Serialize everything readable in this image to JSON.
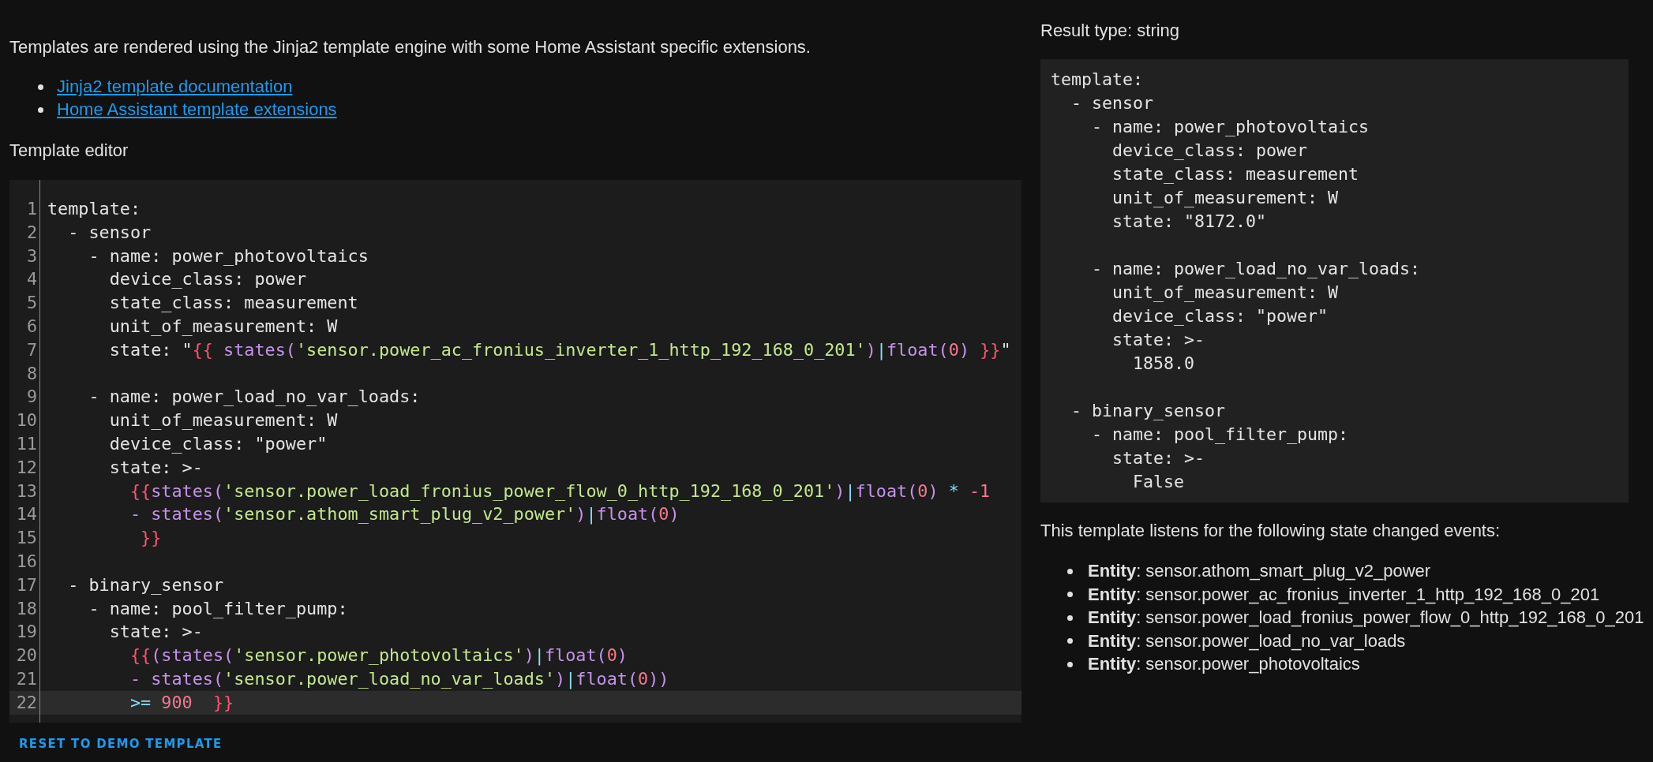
{
  "intro": "Templates are rendered using the Jinja2 template engine with some Home Assistant specific extensions.",
  "links": [
    "Jinja2 template documentation",
    "Home Assistant template extensions"
  ],
  "editor_label": "Template editor",
  "editor": {
    "lines": [
      {
        "number": "1",
        "active": false,
        "tokens": [
          {
            "kind": "plain",
            "text": "template:"
          }
        ]
      },
      {
        "number": "2",
        "active": false,
        "tokens": [
          {
            "kind": "plain",
            "text": "  - sensor"
          }
        ]
      },
      {
        "number": "3",
        "active": false,
        "tokens": [
          {
            "kind": "plain",
            "text": "    - name: power_photovoltaics"
          }
        ]
      },
      {
        "number": "4",
        "active": false,
        "tokens": [
          {
            "kind": "plain",
            "text": "      device_class: power"
          }
        ]
      },
      {
        "number": "5",
        "active": false,
        "tokens": [
          {
            "kind": "plain",
            "text": "      state_class: measurement"
          }
        ]
      },
      {
        "number": "6",
        "active": false,
        "tokens": [
          {
            "kind": "plain",
            "text": "      unit_of_measurement: W"
          }
        ]
      },
      {
        "number": "7",
        "active": false,
        "tokens": [
          {
            "kind": "plain",
            "text": "      state: \""
          },
          {
            "kind": "brace",
            "text": "{{ "
          },
          {
            "kind": "func",
            "text": "states("
          },
          {
            "kind": "string",
            "text": "'sensor.power_ac_fronius_inverter_1_http_192_168_0_201'"
          },
          {
            "kind": "func",
            "text": ")"
          },
          {
            "kind": "op",
            "text": "|"
          },
          {
            "kind": "func",
            "text": "float("
          },
          {
            "kind": "number",
            "text": "0"
          },
          {
            "kind": "func",
            "text": ") "
          },
          {
            "kind": "brace",
            "text": "}}"
          },
          {
            "kind": "plain",
            "text": "\""
          }
        ]
      },
      {
        "number": "8",
        "active": false
      },
      {
        "number": "9",
        "active": false,
        "tokens": [
          {
            "kind": "plain",
            "text": "    - name: power_load_no_var_loads:"
          }
        ]
      },
      {
        "number": "10",
        "active": false,
        "tokens": [
          {
            "kind": "plain",
            "text": "      unit_of_measurement: W"
          }
        ]
      },
      {
        "number": "11",
        "active": false,
        "tokens": [
          {
            "kind": "plain",
            "text": "      device_class: \"power\""
          }
        ]
      },
      {
        "number": "12",
        "active": false,
        "tokens": [
          {
            "kind": "plain",
            "text": "      state: >-"
          }
        ]
      },
      {
        "number": "13",
        "active": false,
        "tokens": [
          {
            "kind": "brace",
            "text": "        {{"
          },
          {
            "kind": "func",
            "text": "states("
          },
          {
            "kind": "string",
            "text": "'sensor.power_load_fronius_power_flow_0_http_192_168_0_201'"
          },
          {
            "kind": "func",
            "text": ")"
          },
          {
            "kind": "op",
            "text": "|"
          },
          {
            "kind": "func",
            "text": "float("
          },
          {
            "kind": "number",
            "text": "0"
          },
          {
            "kind": "func",
            "text": ") "
          },
          {
            "kind": "op",
            "text": "* "
          },
          {
            "kind": "number",
            "text": "-1"
          }
        ]
      },
      {
        "number": "14",
        "active": false,
        "tokens": [
          {
            "kind": "func",
            "text": "        - states("
          },
          {
            "kind": "string",
            "text": "'sensor.athom_smart_plug_v2_power'"
          },
          {
            "kind": "func",
            "text": ")"
          },
          {
            "kind": "op",
            "text": "|"
          },
          {
            "kind": "func",
            "text": "float("
          },
          {
            "kind": "number",
            "text": "0"
          },
          {
            "kind": "func",
            "text": ")"
          }
        ]
      },
      {
        "number": "15",
        "active": false,
        "tokens": [
          {
            "kind": "brace",
            "text": "         }}"
          }
        ]
      },
      {
        "number": "16",
        "active": false
      },
      {
        "number": "17",
        "active": false,
        "tokens": [
          {
            "kind": "plain",
            "text": "  - binary_sensor"
          }
        ]
      },
      {
        "number": "18",
        "active": false,
        "tokens": [
          {
            "kind": "plain",
            "text": "    - name: pool_filter_pump:"
          }
        ]
      },
      {
        "number": "19",
        "active": false,
        "tokens": [
          {
            "kind": "plain",
            "text": "      state: >-"
          }
        ]
      },
      {
        "number": "20",
        "active": false,
        "tokens": [
          {
            "kind": "brace",
            "text": "        {{"
          },
          {
            "kind": "func",
            "text": "(states("
          },
          {
            "kind": "string",
            "text": "'sensor.power_photovoltaics'"
          },
          {
            "kind": "func",
            "text": ")"
          },
          {
            "kind": "op",
            "text": "|"
          },
          {
            "kind": "func",
            "text": "float("
          },
          {
            "kind": "number",
            "text": "0"
          },
          {
            "kind": "func",
            "text": ")"
          }
        ]
      },
      {
        "number": "21",
        "active": false,
        "tokens": [
          {
            "kind": "func",
            "text": "        - states("
          },
          {
            "kind": "string",
            "text": "'sensor.power_load_no_var_loads'"
          },
          {
            "kind": "func",
            "text": ")"
          },
          {
            "kind": "op",
            "text": "|"
          },
          {
            "kind": "func",
            "text": "float("
          },
          {
            "kind": "number",
            "text": "0"
          },
          {
            "kind": "func",
            "text": "))"
          }
        ]
      },
      {
        "number": "22",
        "active": true,
        "tokens": [
          {
            "kind": "op",
            "text": "        >= "
          },
          {
            "kind": "number",
            "text": "900  "
          },
          {
            "kind": "brace",
            "text": "}}"
          }
        ]
      }
    ]
  },
  "reset_button": "RESET TO DEMO TEMPLATE",
  "result_type": "Result type: string",
  "result_blocks": [
    [
      "template:",
      "  - sensor",
      "    - name: power_photovoltaics",
      "      device_class: power",
      "      state_class: measurement",
      "      unit_of_measurement: W",
      "      state: \"8172.0\""
    ],
    [
      "    - name: power_load_no_var_loads:",
      "      unit_of_measurement: W",
      "      device_class: \"power\"",
      "      state: >-",
      "        1858.0"
    ],
    [
      "  - binary_sensor",
      "    - name: pool_filter_pump:",
      "      state: >-",
      "        False"
    ]
  ],
  "listens_text": "This template listens for the following state changed events:",
  "entities": [
    "**Entity**: sensor.athom_smart_plug_v2_power",
    "**Entity**: sensor.power_ac_fronius_inverter_1_http_192_168_0_201",
    "**Entity**: sensor.power_load_fronius_power_flow_0_http_192_168_0_201",
    "**Entity**: sensor.power_load_no_var_loads",
    "**Entity**: sensor.power_photovoltaics"
  ]
}
